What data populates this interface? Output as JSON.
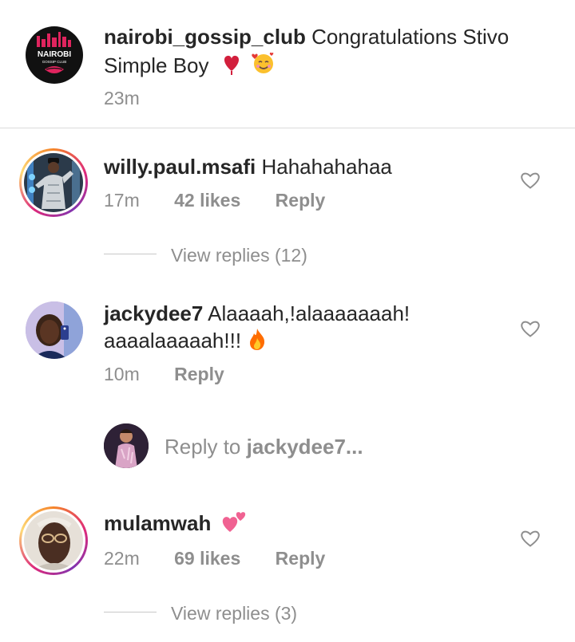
{
  "caption": {
    "username": "nairobi_gossip_club",
    "text": "Congratulations Stivo",
    "text2": "Simple Boy",
    "time": "23m",
    "avatar_logo_line1": "NAIROBI",
    "avatar_logo_line2": "GOSSIP CLUB",
    "emojis": [
      "red-heart",
      "smiling-face-with-hearts"
    ]
  },
  "comments": [
    {
      "username": "willy.paul.msafi",
      "text": "Hahahahahaa",
      "time": "17m",
      "likes": "42 likes",
      "reply": "Reply",
      "view_replies": "View replies (12)"
    },
    {
      "username": "jackydee7",
      "text": "Alaaaah,!alaaaaaaah!",
      "text2": "aaaalaaaaah!!!",
      "time": "10m",
      "reply": "Reply",
      "emoji": "fire"
    },
    {
      "username": "mulamwah",
      "text": "",
      "time": "22m",
      "likes": "69 likes",
      "reply": "Reply",
      "view_replies": "View replies (3)",
      "emoji": "two-hearts"
    }
  ],
  "reply_box": {
    "prefix": "Reply to ",
    "target": "jackydee7..."
  },
  "colors": {
    "text": "#262626",
    "muted": "#8e8e8e",
    "story_ring": "#dd2a7b"
  }
}
